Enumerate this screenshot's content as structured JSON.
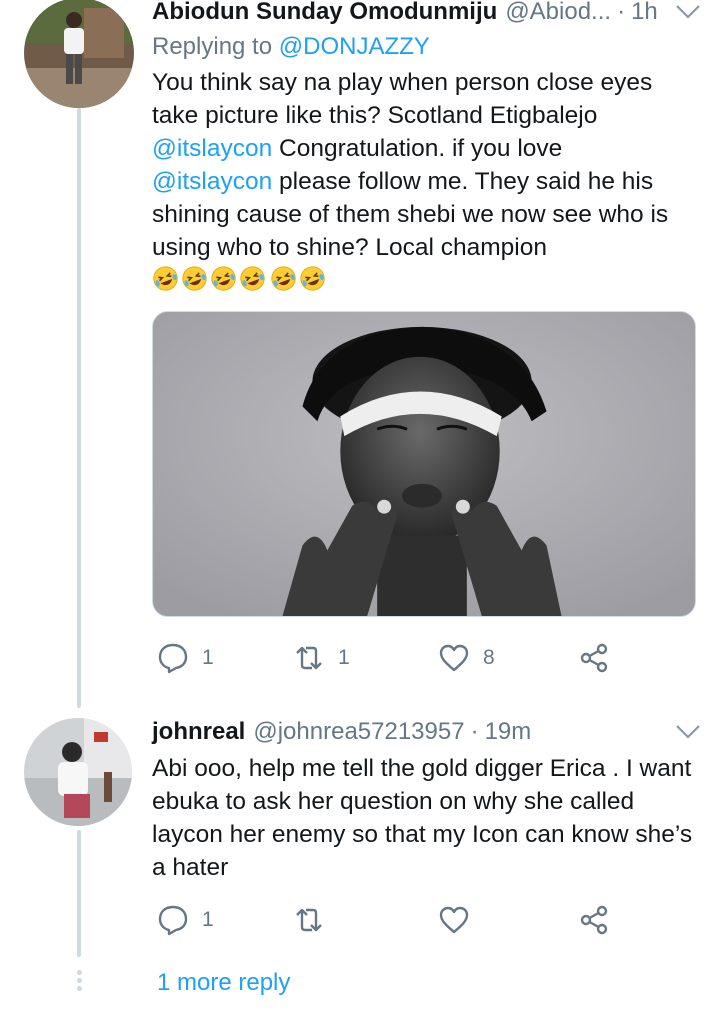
{
  "tweet1": {
    "name": "Abiodun Sunday Omodunmiju",
    "handle": "@Abiod...",
    "separator": "·",
    "time": "1h",
    "replying_prefix": "Replying to",
    "replying_to": "@DONJAZZY",
    "text_1": "You think say na play when person close eyes take picture like this? Scotland Etigbalejo",
    "mention_1": "@itslaycon",
    "text_2": " Congratulation. if you love ",
    "mention_2": "@itslaycon",
    "text_3": " please follow me. They said he his shining cause of them shebi we now see who is using who to shine? Local champion ",
    "emoji_name": "rolling-on-floor-laughing",
    "emoji_count": 6,
    "reply_count": "1",
    "retweet_count": "1",
    "like_count": "8"
  },
  "tweet2": {
    "name": "johnreal",
    "handle": "@johnrea57213957",
    "separator": "·",
    "time": "19m",
    "text": "Abi ooo, help me tell the gold digger Erica . I want ebuka to ask her question on why she called laycon her enemy so that my Icon can know she’s a hater",
    "reply_count": "1",
    "retweet_count": "",
    "like_count": ""
  },
  "more_reply": "1 more reply",
  "colors": {
    "link": "#1da1f2",
    "muted": "#657786",
    "text": "#14171a",
    "thread_line": "#cfd9de"
  },
  "icons": [
    "chevron-down-icon",
    "reply-icon",
    "retweet-icon",
    "like-icon",
    "share-icon"
  ]
}
